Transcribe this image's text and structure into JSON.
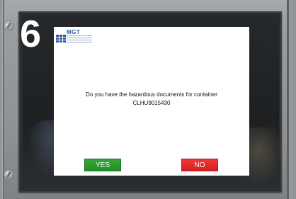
{
  "overlay": {
    "step_number": "6"
  },
  "dialog": {
    "logo_text": "MGT",
    "question_line1": "Do you have the hazardous documents for container",
    "question_line2": "CLHU9015430",
    "yes_label": "YES",
    "no_label": "NO"
  },
  "colors": {
    "yes_button": "#1f8f27",
    "no_button": "#d41e1e",
    "brand_blue": "#2c5aa0"
  }
}
